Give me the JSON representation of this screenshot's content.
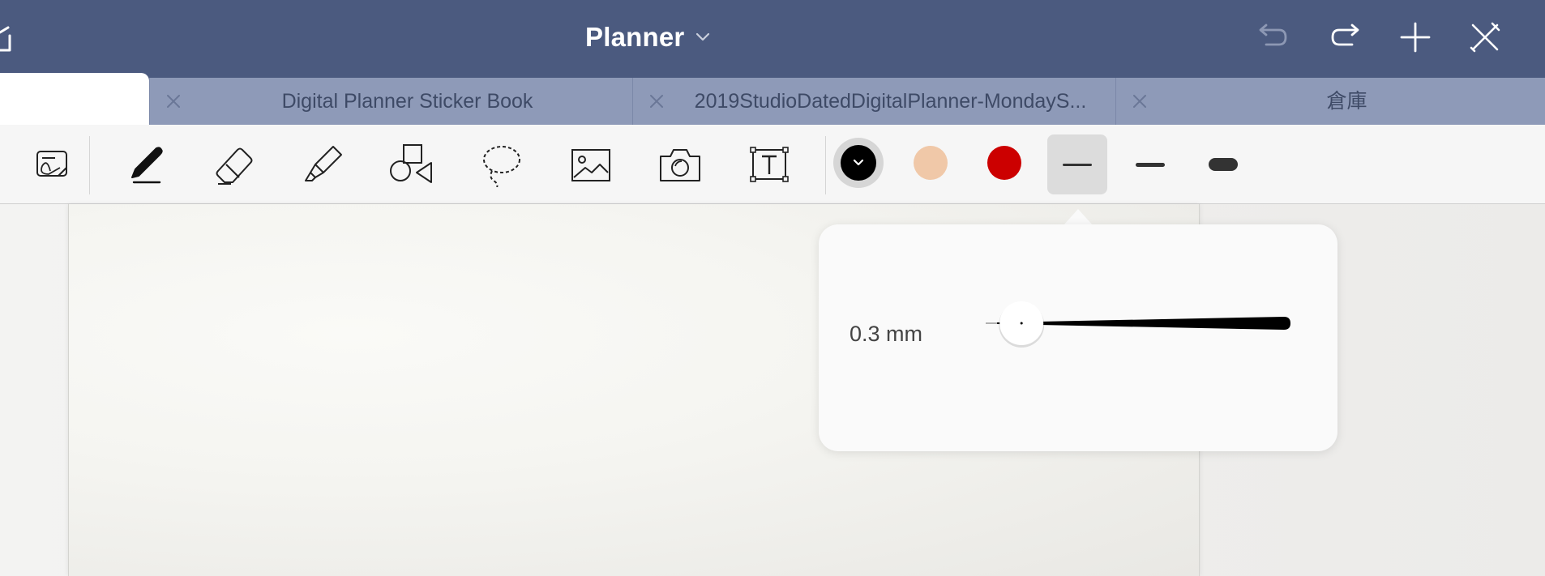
{
  "window": {
    "title": "Planner"
  },
  "tabs": [
    {
      "label": "",
      "active": true
    },
    {
      "label": "Digital Planner Sticker Book",
      "active": false
    },
    {
      "label": "2019StudioDatedDigitalPlanner-MondayS...",
      "active": false
    },
    {
      "label": "倉庫",
      "active": false
    }
  ],
  "toolbar": {
    "tools": [
      "read-mode-icon",
      "pen-icon",
      "eraser-icon",
      "highlighter-icon",
      "shapes-icon",
      "lasso-icon",
      "image-icon",
      "camera-icon",
      "text-icon"
    ],
    "selected_tool": "pen-icon",
    "colors": [
      "#000000",
      "#f0c8a8",
      "#cc0000"
    ],
    "selected_color": "#000000",
    "thicknesses": [
      "thin",
      "medium",
      "thick"
    ],
    "selected_thickness": "thin"
  },
  "pen_size_popover": {
    "size_label": "0.3 mm",
    "slider_value": 0.1
  },
  "colors": {
    "titlebar": "#4b5a7f",
    "tab_inactive": "#8e9ab8",
    "accent_red": "#cc0000"
  }
}
